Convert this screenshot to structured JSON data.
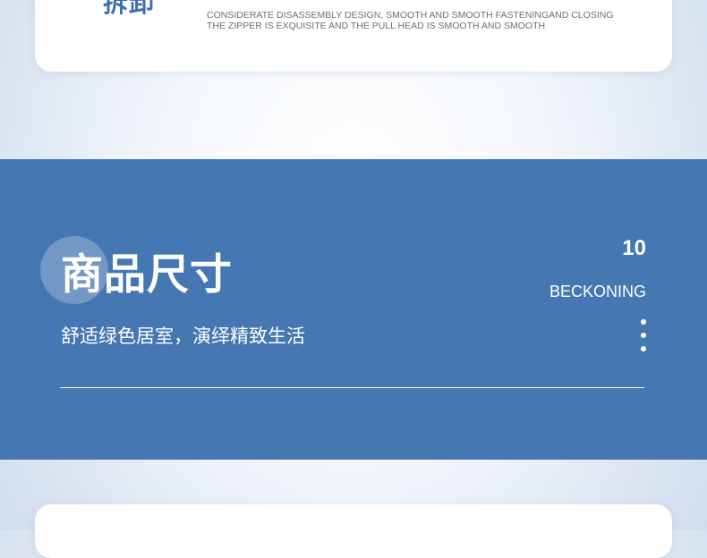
{
  "feature": {
    "title": "拆卸",
    "description_line1": "CONSIDERATE DISASSEMBLY DESIGN, SMOOTH AND SMOOTH FASTENINGAND CLOSING",
    "description_line2": "THE ZIPPER IS EXQUISITE AND THE PULL HEAD IS SMOOTH AND SMOOTH"
  },
  "section": {
    "title": "商品尺寸",
    "subtitle": "舒适绿色居室，演绎精致生活",
    "number": "10",
    "english": "BECKONING",
    "band_color": "#4577b2",
    "accent_color": "#3f6fae"
  }
}
